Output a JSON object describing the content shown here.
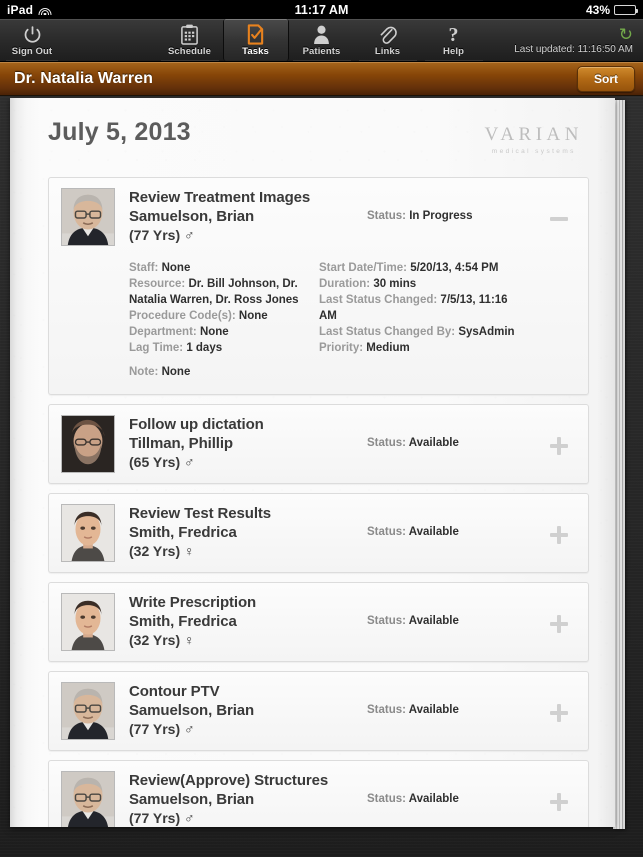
{
  "status_bar": {
    "device": "iPad",
    "wifi_icon": "wifi-icon",
    "time": "11:17 AM",
    "battery_percent": "43%",
    "battery_level": 43
  },
  "toolbar": {
    "sign_out": {
      "label": "Sign Out",
      "icon": "power-icon"
    },
    "items": [
      {
        "label": "Schedule",
        "icon": "calendar-clipboard-icon",
        "selected": false
      },
      {
        "label": "Tasks",
        "icon": "document-check-icon",
        "selected": true
      },
      {
        "label": "Patients",
        "icon": "person-icon",
        "selected": false
      },
      {
        "label": "Links",
        "icon": "paperclip-icon",
        "selected": false
      },
      {
        "label": "Help",
        "icon": "question-mark-icon",
        "selected": false
      }
    ],
    "last_updated": "Last updated: 11:16:50 AM",
    "refresh_icon": "refresh-circular-arrow-icon"
  },
  "title_bar": {
    "doctor_name": "Dr. Natalia Warren",
    "sort_label": "Sort",
    "accent_color": "#874608"
  },
  "page": {
    "date": "July 5, 2013",
    "logo": {
      "word": "VARIAN",
      "subtitle": "medical systems"
    }
  },
  "tasks": [
    {
      "title": "Review Treatment Images",
      "patient": "Samuelson, Brian",
      "age": "(77 Yrs)",
      "gender": "♂",
      "status_label": "Status:",
      "status_value": "In Progress",
      "expanded": true,
      "toggle_icon": "minus-icon",
      "avatar": "elderly-man-photo",
      "details_left": [
        {
          "label": "Staff:",
          "value": "None"
        },
        {
          "label": "Resource:",
          "value": "Dr. Bill Johnson, Dr. Natalia Warren, Dr. Ross Jones"
        },
        {
          "label": "Procedure Code(s):",
          "value": "None"
        },
        {
          "label": "Department:",
          "value": "None"
        },
        {
          "label": "Lag Time:",
          "value": "1 days"
        },
        {
          "label": "Note:",
          "value": "None"
        }
      ],
      "details_right": [
        {
          "label": "Start Date/Time:",
          "value": "5/20/13, 4:54 PM"
        },
        {
          "label": "Duration:",
          "value": "30 mins"
        },
        {
          "label": "Last Status Changed:",
          "value": "7/5/13, 11:16 AM"
        },
        {
          "label": "Last Status Changed By:",
          "value": "SysAdmin"
        },
        {
          "label": "Priority:",
          "value": "Medium"
        }
      ]
    },
    {
      "title": "Follow up dictation",
      "patient": "Tillman, Phillip",
      "age": "(65 Yrs)",
      "gender": "♂",
      "status_label": "Status:",
      "status_value": "Available",
      "expanded": false,
      "toggle_icon": "plus-icon",
      "avatar": "bearded-man-photo"
    },
    {
      "title": "Review Test Results",
      "patient": "Smith, Fredrica",
      "age": "(32 Yrs)",
      "gender": "♀",
      "status_label": "Status:",
      "status_value": "Available",
      "expanded": false,
      "toggle_icon": "plus-icon",
      "avatar": "young-woman-photo"
    },
    {
      "title": "Write Prescription",
      "patient": "Smith, Fredrica",
      "age": "(32 Yrs)",
      "gender": "♀",
      "status_label": "Status:",
      "status_value": "Available",
      "expanded": false,
      "toggle_icon": "plus-icon",
      "avatar": "young-woman-photo"
    },
    {
      "title": "Contour PTV",
      "patient": "Samuelson, Brian",
      "age": "(77 Yrs)",
      "gender": "♂",
      "status_label": "Status:",
      "status_value": "Available",
      "expanded": false,
      "toggle_icon": "plus-icon",
      "avatar": "elderly-man-photo"
    },
    {
      "title": "Review(Approve) Structures",
      "patient": "Samuelson, Brian",
      "age": "(77 Yrs)",
      "gender": "♂",
      "status_label": "Status:",
      "status_value": "Available",
      "expanded": false,
      "toggle_icon": "plus-icon",
      "avatar": "elderly-man-photo"
    }
  ]
}
